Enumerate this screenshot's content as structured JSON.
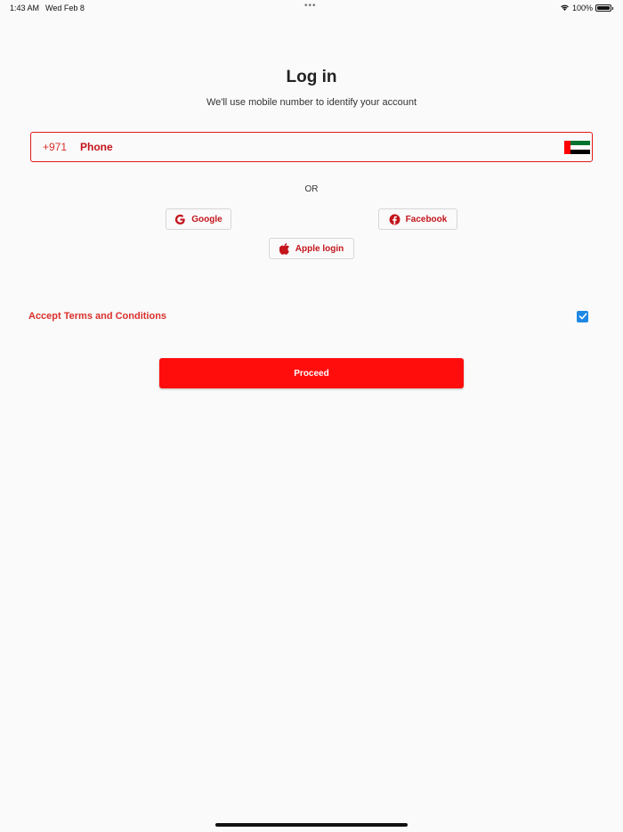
{
  "status_bar": {
    "time": "1:43 AM",
    "date": "Wed Feb 8",
    "battery": "100%",
    "dots": "•••"
  },
  "login": {
    "title": "Log in",
    "subtitle": "We'll use mobile number to identify your account"
  },
  "phone": {
    "country_code": "+971",
    "placeholder": "Phone",
    "value": "",
    "flag_colors": {
      "red": "#ff0000",
      "green": "#00732f",
      "white": "#ffffff",
      "black": "#000000"
    }
  },
  "separator": {
    "or_label": "OR"
  },
  "social": {
    "google_label": "Google",
    "facebook_label": "Facebook",
    "apple_label": "Apple login"
  },
  "terms": {
    "label": "Accept Terms and Conditions",
    "checked": true
  },
  "actions": {
    "proceed_label": "Proceed"
  },
  "colors": {
    "accent": "#ff0d0d",
    "text_red": "#c4151c",
    "checkbox": "#1e88e5"
  }
}
